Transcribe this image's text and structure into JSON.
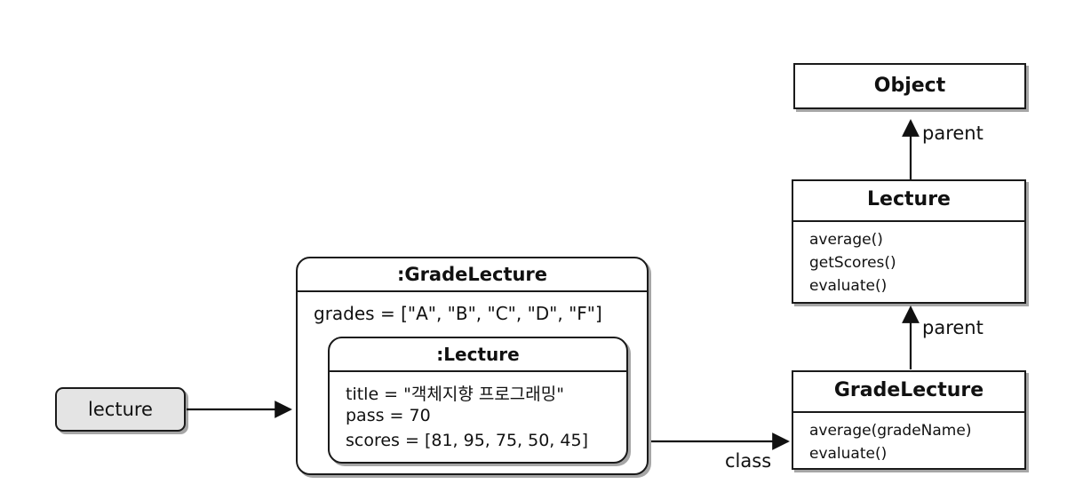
{
  "variable": {
    "name": "lecture"
  },
  "instance": {
    "title": ":GradeLecture",
    "fields": [
      "grades = [\"A\", \"B\", \"C\", \"D\", \"F\"]"
    ],
    "parent_part": {
      "title": ":Lecture",
      "fields": [
        "title = \"객체지향 프로그래밍\"",
        "pass = 70",
        "scores = [81, 95, 75, 50, 45]"
      ]
    }
  },
  "classes": {
    "object": {
      "name": "Object"
    },
    "lecture": {
      "name": "Lecture",
      "methods": [
        "average()",
        "getScores()",
        "evaluate()"
      ]
    },
    "grade_lecture": {
      "name": "GradeLecture",
      "methods": [
        "average(gradeName)",
        "evaluate()"
      ]
    }
  },
  "edges": {
    "class_label": "class",
    "parent_label_upper": "parent",
    "parent_label_lower": "parent"
  }
}
